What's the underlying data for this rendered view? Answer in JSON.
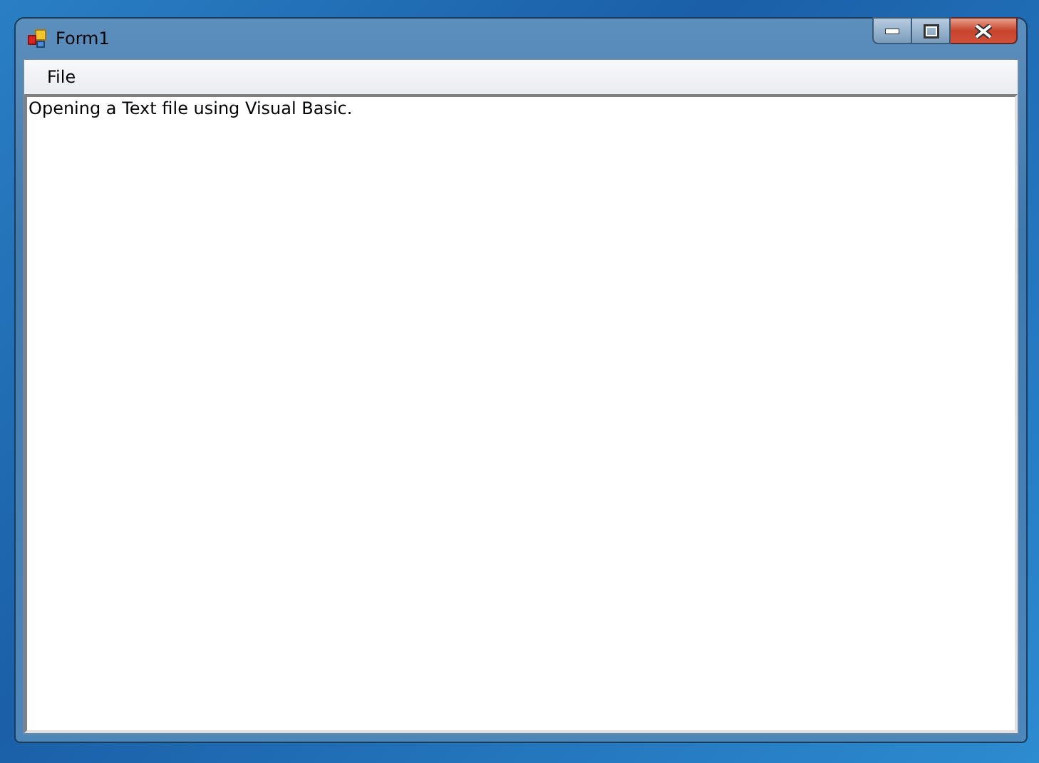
{
  "window": {
    "title": "Form1"
  },
  "menu": [
    {
      "label": "File"
    }
  ],
  "textbox": {
    "value": "Opening a Text file using Visual Basic."
  }
}
